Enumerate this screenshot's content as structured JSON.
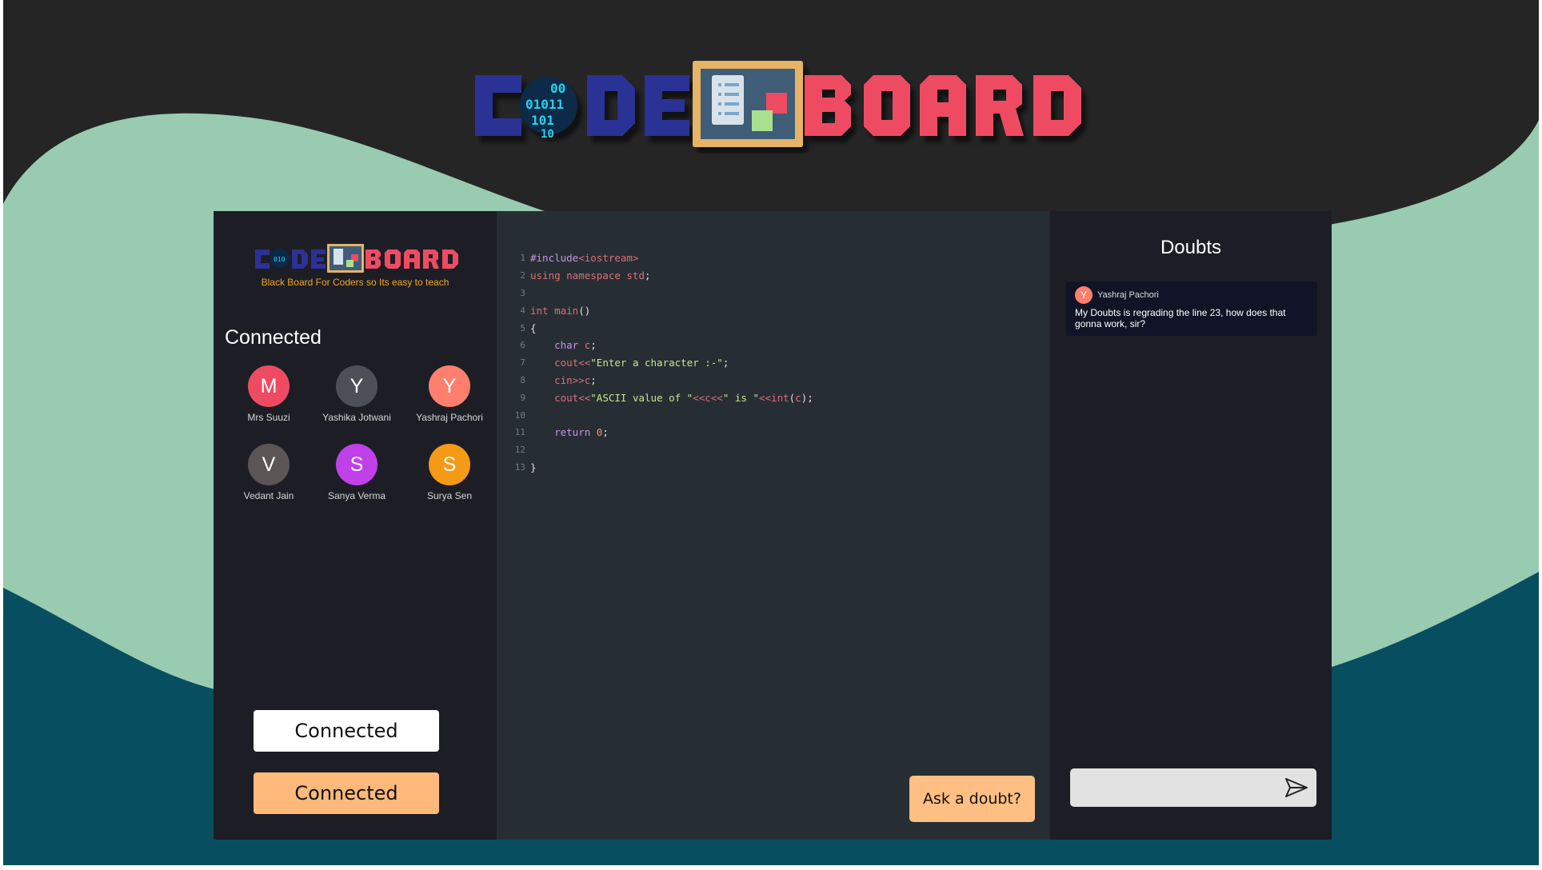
{
  "brand": {
    "logo_text_code": "CODE",
    "logo_text_board": "BOARD",
    "logo_binary": [
      "00",
      "01011",
      "101",
      "10"
    ],
    "tagline": "Black Board For Coders so Its easy to teach",
    "colors": {
      "code": "#2c3196",
      "board": "#ee4b63",
      "binary": "#22d3ee",
      "board_frame": "#e6b466"
    }
  },
  "sidebar": {
    "connected_title": "Connected",
    "users": [
      {
        "initial": "M",
        "name": "Mrs Suuzi",
        "color": "#ee4b63"
      },
      {
        "initial": "Y",
        "name": "Yashika Jotwani",
        "color": "#4e5059"
      },
      {
        "initial": "Y",
        "name": "Yashraj Pachori",
        "color": "#ff7f6e"
      },
      {
        "initial": "V",
        "name": "Vedant Jain",
        "color": "#5c5556"
      },
      {
        "initial": "S",
        "name": "Sanya Verma",
        "color": "#c041ea"
      },
      {
        "initial": "S",
        "name": "Surya Sen",
        "color": "#f59a16"
      }
    ],
    "button_primary": "Connected",
    "button_secondary": "Connected"
  },
  "editor": {
    "line_numbers": [
      "1",
      "2",
      "3",
      "4",
      "5",
      "6",
      "7",
      "8",
      "9",
      "10",
      "11",
      "12",
      "13"
    ],
    "ask_doubt_label": "Ask a doubt?"
  },
  "doubts": {
    "title": "Doubts",
    "items": [
      {
        "initial": "Y",
        "author": "Yashraj Pachori",
        "text": "My Doubts is regrading the line 23, how does that gonna work, sir?"
      }
    ],
    "input_placeholder": "",
    "send_icon": "send-icon"
  },
  "colors": {
    "background_dark": "#252525",
    "wave_mint": "#98cbb0",
    "wave_teal": "#074e60",
    "panel": "#1d1e25",
    "editor": "#272e33",
    "accent_orange": "#ffb97a"
  }
}
